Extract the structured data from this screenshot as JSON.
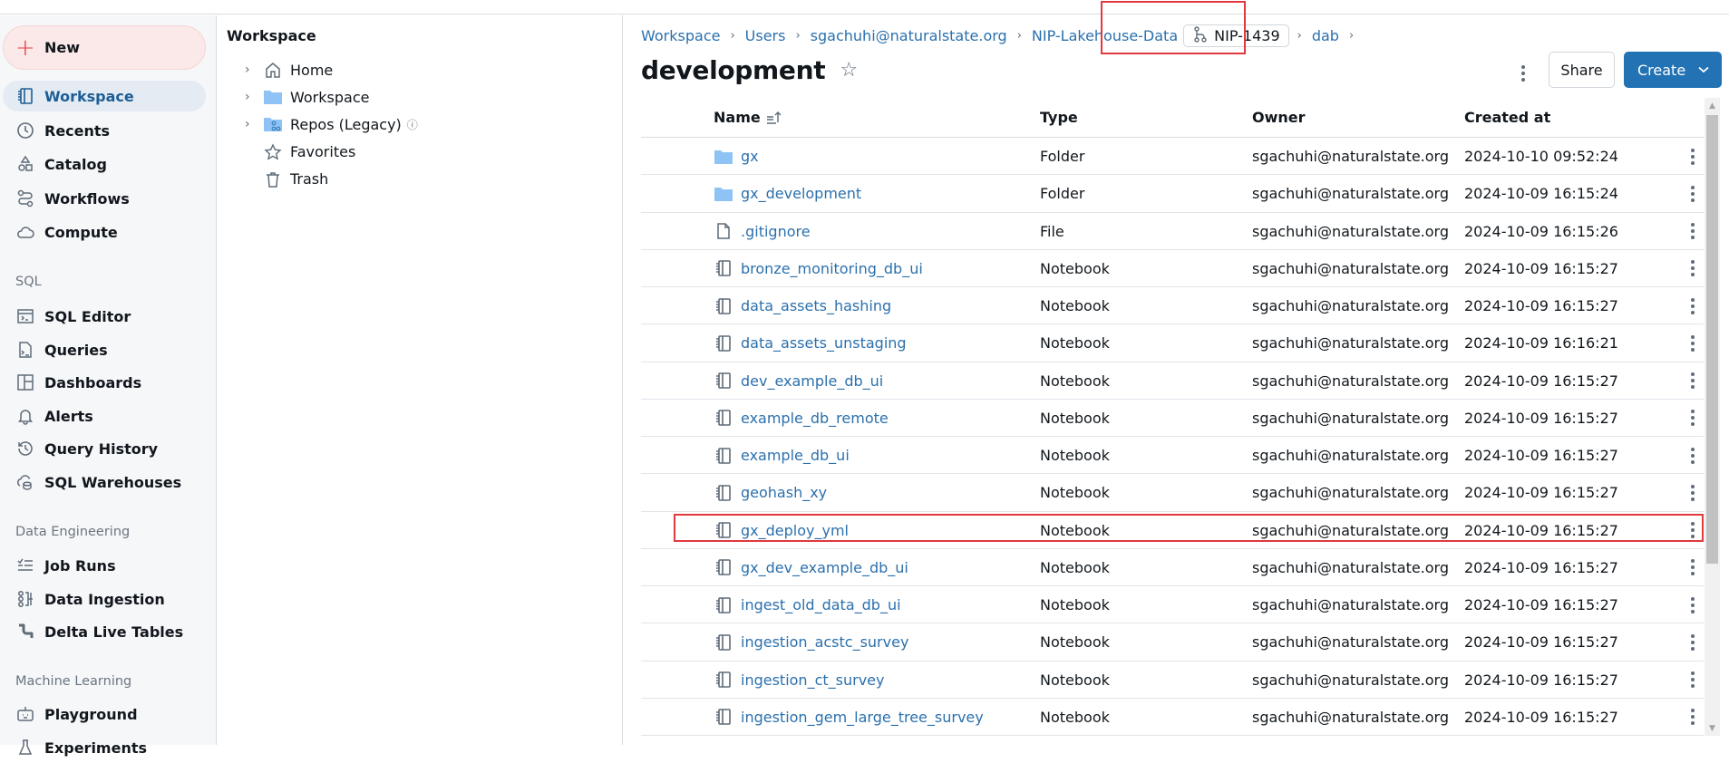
{
  "sidebar": {
    "new_label": "New",
    "items_top": [
      {
        "label": "Workspace",
        "icon": "notebook-icon",
        "active": true
      },
      {
        "label": "Recents",
        "icon": "clock-icon"
      },
      {
        "label": "Catalog",
        "icon": "catalog-icon"
      },
      {
        "label": "Workflows",
        "icon": "workflows-icon"
      },
      {
        "label": "Compute",
        "icon": "cloud-icon"
      }
    ],
    "sql_section": "SQL",
    "sql_items": [
      {
        "label": "SQL Editor",
        "icon": "sql-editor-icon"
      },
      {
        "label": "Queries",
        "icon": "queries-icon"
      },
      {
        "label": "Dashboards",
        "icon": "dashboards-icon"
      },
      {
        "label": "Alerts",
        "icon": "bell-icon"
      },
      {
        "label": "Query History",
        "icon": "history-icon"
      },
      {
        "label": "SQL Warehouses",
        "icon": "warehouse-icon"
      }
    ],
    "de_section": "Data Engineering",
    "de_items": [
      {
        "label": "Job Runs",
        "icon": "job-runs-icon"
      },
      {
        "label": "Data Ingestion",
        "icon": "ingestion-icon"
      },
      {
        "label": "Delta Live Tables",
        "icon": "pipeline-icon"
      }
    ],
    "ml_section": "Machine Learning",
    "ml_items": [
      {
        "label": "Playground",
        "icon": "robot-icon"
      },
      {
        "label": "Experiments",
        "icon": "flask-icon"
      }
    ]
  },
  "tree": {
    "title": "Workspace",
    "items": [
      {
        "label": "Home",
        "icon": "home-icon",
        "expandable": true
      },
      {
        "label": "Workspace",
        "icon": "folder-icon",
        "expandable": true
      },
      {
        "label": "Repos (Legacy)",
        "icon": "repo-folder-icon",
        "expandable": true,
        "info": "ⓘ"
      },
      {
        "label": "Favorites",
        "icon": "star-icon",
        "expandable": false
      },
      {
        "label": "Trash",
        "icon": "trash-icon",
        "expandable": false
      }
    ]
  },
  "breadcrumb": {
    "items": [
      "Workspace",
      "Users",
      "sgachuhi@naturalstate.org",
      "NIP-Lakehouse-Data"
    ],
    "branch": "NIP-1439",
    "after_branch": "dab"
  },
  "page": {
    "title": "development",
    "share_label": "Share",
    "create_label": "Create"
  },
  "table": {
    "headers": {
      "name": "Name",
      "type": "Type",
      "owner": "Owner",
      "created": "Created at"
    },
    "sort": "name-ascending",
    "rows": [
      {
        "name": "gx",
        "type": "Folder",
        "owner": "sgachuhi@naturalstate.org",
        "created": "2024-10-10 09:52:24",
        "icon": "folder"
      },
      {
        "name": "gx_development",
        "type": "Folder",
        "owner": "sgachuhi@naturalstate.org",
        "created": "2024-10-09 16:15:24",
        "icon": "folder"
      },
      {
        "name": ".gitignore",
        "type": "File",
        "owner": "sgachuhi@naturalstate.org",
        "created": "2024-10-09 16:15:26",
        "icon": "file"
      },
      {
        "name": "bronze_monitoring_db_ui",
        "type": "Notebook",
        "owner": "sgachuhi@naturalstate.org",
        "created": "2024-10-09 16:15:27",
        "icon": "notebook"
      },
      {
        "name": "data_assets_hashing",
        "type": "Notebook",
        "owner": "sgachuhi@naturalstate.org",
        "created": "2024-10-09 16:15:27",
        "icon": "notebook"
      },
      {
        "name": "data_assets_unstaging",
        "type": "Notebook",
        "owner": "sgachuhi@naturalstate.org",
        "created": "2024-10-09 16:16:21",
        "icon": "notebook"
      },
      {
        "name": "dev_example_db_ui",
        "type": "Notebook",
        "owner": "sgachuhi@naturalstate.org",
        "created": "2024-10-09 16:15:27",
        "icon": "notebook"
      },
      {
        "name": "example_db_remote",
        "type": "Notebook",
        "owner": "sgachuhi@naturalstate.org",
        "created": "2024-10-09 16:15:27",
        "icon": "notebook"
      },
      {
        "name": "example_db_ui",
        "type": "Notebook",
        "owner": "sgachuhi@naturalstate.org",
        "created": "2024-10-09 16:15:27",
        "icon": "notebook"
      },
      {
        "name": "geohash_xy",
        "type": "Notebook",
        "owner": "sgachuhi@naturalstate.org",
        "created": "2024-10-09 16:15:27",
        "icon": "notebook"
      },
      {
        "name": "gx_deploy_yml",
        "type": "Notebook",
        "owner": "sgachuhi@naturalstate.org",
        "created": "2024-10-09 16:15:27",
        "icon": "notebook",
        "highlighted": true
      },
      {
        "name": "gx_dev_example_db_ui",
        "type": "Notebook",
        "owner": "sgachuhi@naturalstate.org",
        "created": "2024-10-09 16:15:27",
        "icon": "notebook"
      },
      {
        "name": "ingest_old_data_db_ui",
        "type": "Notebook",
        "owner": "sgachuhi@naturalstate.org",
        "created": "2024-10-09 16:15:27",
        "icon": "notebook"
      },
      {
        "name": "ingestion_acstc_survey",
        "type": "Notebook",
        "owner": "sgachuhi@naturalstate.org",
        "created": "2024-10-09 16:15:27",
        "icon": "notebook"
      },
      {
        "name": "ingestion_ct_survey",
        "type": "Notebook",
        "owner": "sgachuhi@naturalstate.org",
        "created": "2024-10-09 16:15:27",
        "icon": "notebook"
      },
      {
        "name": "ingestion_gem_large_tree_survey",
        "type": "Notebook",
        "owner": "sgachuhi@naturalstate.org",
        "created": "2024-10-09 16:15:27",
        "icon": "notebook"
      }
    ]
  },
  "colors": {
    "accent": "#2272b4",
    "link": "#2b70ad",
    "highlight": "#e0393e",
    "new_button_bg": "#fbe9e9",
    "sidebar_active_bg": "#e4ebf2",
    "folder": "#8fc3f5"
  }
}
